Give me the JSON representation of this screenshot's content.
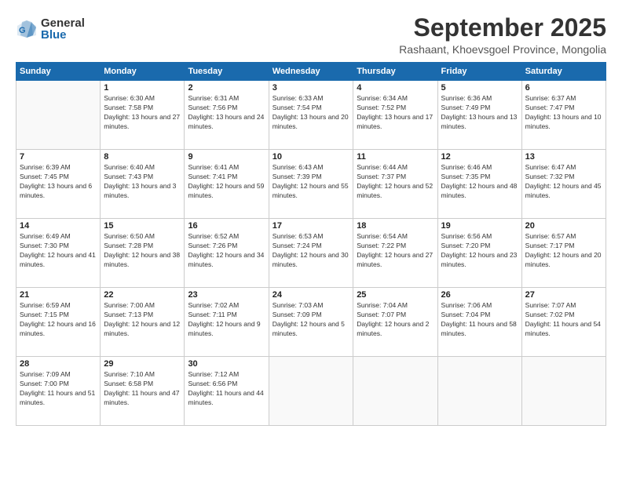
{
  "header": {
    "logo_general": "General",
    "logo_blue": "Blue",
    "month": "September 2025",
    "location": "Rashaant, Khoevsgoel Province, Mongolia"
  },
  "days": [
    "Sunday",
    "Monday",
    "Tuesday",
    "Wednesday",
    "Thursday",
    "Friday",
    "Saturday"
  ],
  "weeks": [
    [
      {
        "date": "",
        "sunrise": "",
        "sunset": "",
        "daylight": ""
      },
      {
        "date": "1",
        "sunrise": "Sunrise: 6:30 AM",
        "sunset": "Sunset: 7:58 PM",
        "daylight": "Daylight: 13 hours and 27 minutes."
      },
      {
        "date": "2",
        "sunrise": "Sunrise: 6:31 AM",
        "sunset": "Sunset: 7:56 PM",
        "daylight": "Daylight: 13 hours and 24 minutes."
      },
      {
        "date": "3",
        "sunrise": "Sunrise: 6:33 AM",
        "sunset": "Sunset: 7:54 PM",
        "daylight": "Daylight: 13 hours and 20 minutes."
      },
      {
        "date": "4",
        "sunrise": "Sunrise: 6:34 AM",
        "sunset": "Sunset: 7:52 PM",
        "daylight": "Daylight: 13 hours and 17 minutes."
      },
      {
        "date": "5",
        "sunrise": "Sunrise: 6:36 AM",
        "sunset": "Sunset: 7:49 PM",
        "daylight": "Daylight: 13 hours and 13 minutes."
      },
      {
        "date": "6",
        "sunrise": "Sunrise: 6:37 AM",
        "sunset": "Sunset: 7:47 PM",
        "daylight": "Daylight: 13 hours and 10 minutes."
      }
    ],
    [
      {
        "date": "7",
        "sunrise": "Sunrise: 6:39 AM",
        "sunset": "Sunset: 7:45 PM",
        "daylight": "Daylight: 13 hours and 6 minutes."
      },
      {
        "date": "8",
        "sunrise": "Sunrise: 6:40 AM",
        "sunset": "Sunset: 7:43 PM",
        "daylight": "Daylight: 13 hours and 3 minutes."
      },
      {
        "date": "9",
        "sunrise": "Sunrise: 6:41 AM",
        "sunset": "Sunset: 7:41 PM",
        "daylight": "Daylight: 12 hours and 59 minutes."
      },
      {
        "date": "10",
        "sunrise": "Sunrise: 6:43 AM",
        "sunset": "Sunset: 7:39 PM",
        "daylight": "Daylight: 12 hours and 55 minutes."
      },
      {
        "date": "11",
        "sunrise": "Sunrise: 6:44 AM",
        "sunset": "Sunset: 7:37 PM",
        "daylight": "Daylight: 12 hours and 52 minutes."
      },
      {
        "date": "12",
        "sunrise": "Sunrise: 6:46 AM",
        "sunset": "Sunset: 7:35 PM",
        "daylight": "Daylight: 12 hours and 48 minutes."
      },
      {
        "date": "13",
        "sunrise": "Sunrise: 6:47 AM",
        "sunset": "Sunset: 7:32 PM",
        "daylight": "Daylight: 12 hours and 45 minutes."
      }
    ],
    [
      {
        "date": "14",
        "sunrise": "Sunrise: 6:49 AM",
        "sunset": "Sunset: 7:30 PM",
        "daylight": "Daylight: 12 hours and 41 minutes."
      },
      {
        "date": "15",
        "sunrise": "Sunrise: 6:50 AM",
        "sunset": "Sunset: 7:28 PM",
        "daylight": "Daylight: 12 hours and 38 minutes."
      },
      {
        "date": "16",
        "sunrise": "Sunrise: 6:52 AM",
        "sunset": "Sunset: 7:26 PM",
        "daylight": "Daylight: 12 hours and 34 minutes."
      },
      {
        "date": "17",
        "sunrise": "Sunrise: 6:53 AM",
        "sunset": "Sunset: 7:24 PM",
        "daylight": "Daylight: 12 hours and 30 minutes."
      },
      {
        "date": "18",
        "sunrise": "Sunrise: 6:54 AM",
        "sunset": "Sunset: 7:22 PM",
        "daylight": "Daylight: 12 hours and 27 minutes."
      },
      {
        "date": "19",
        "sunrise": "Sunrise: 6:56 AM",
        "sunset": "Sunset: 7:20 PM",
        "daylight": "Daylight: 12 hours and 23 minutes."
      },
      {
        "date": "20",
        "sunrise": "Sunrise: 6:57 AM",
        "sunset": "Sunset: 7:17 PM",
        "daylight": "Daylight: 12 hours and 20 minutes."
      }
    ],
    [
      {
        "date": "21",
        "sunrise": "Sunrise: 6:59 AM",
        "sunset": "Sunset: 7:15 PM",
        "daylight": "Daylight: 12 hours and 16 minutes."
      },
      {
        "date": "22",
        "sunrise": "Sunrise: 7:00 AM",
        "sunset": "Sunset: 7:13 PM",
        "daylight": "Daylight: 12 hours and 12 minutes."
      },
      {
        "date": "23",
        "sunrise": "Sunrise: 7:02 AM",
        "sunset": "Sunset: 7:11 PM",
        "daylight": "Daylight: 12 hours and 9 minutes."
      },
      {
        "date": "24",
        "sunrise": "Sunrise: 7:03 AM",
        "sunset": "Sunset: 7:09 PM",
        "daylight": "Daylight: 12 hours and 5 minutes."
      },
      {
        "date": "25",
        "sunrise": "Sunrise: 7:04 AM",
        "sunset": "Sunset: 7:07 PM",
        "daylight": "Daylight: 12 hours and 2 minutes."
      },
      {
        "date": "26",
        "sunrise": "Sunrise: 7:06 AM",
        "sunset": "Sunset: 7:04 PM",
        "daylight": "Daylight: 11 hours and 58 minutes."
      },
      {
        "date": "27",
        "sunrise": "Sunrise: 7:07 AM",
        "sunset": "Sunset: 7:02 PM",
        "daylight": "Daylight: 11 hours and 54 minutes."
      }
    ],
    [
      {
        "date": "28",
        "sunrise": "Sunrise: 7:09 AM",
        "sunset": "Sunset: 7:00 PM",
        "daylight": "Daylight: 11 hours and 51 minutes."
      },
      {
        "date": "29",
        "sunrise": "Sunrise: 7:10 AM",
        "sunset": "Sunset: 6:58 PM",
        "daylight": "Daylight: 11 hours and 47 minutes."
      },
      {
        "date": "30",
        "sunrise": "Sunrise: 7:12 AM",
        "sunset": "Sunset: 6:56 PM",
        "daylight": "Daylight: 11 hours and 44 minutes."
      },
      {
        "date": "",
        "sunrise": "",
        "sunset": "",
        "daylight": ""
      },
      {
        "date": "",
        "sunrise": "",
        "sunset": "",
        "daylight": ""
      },
      {
        "date": "",
        "sunrise": "",
        "sunset": "",
        "daylight": ""
      },
      {
        "date": "",
        "sunrise": "",
        "sunset": "",
        "daylight": ""
      }
    ]
  ]
}
